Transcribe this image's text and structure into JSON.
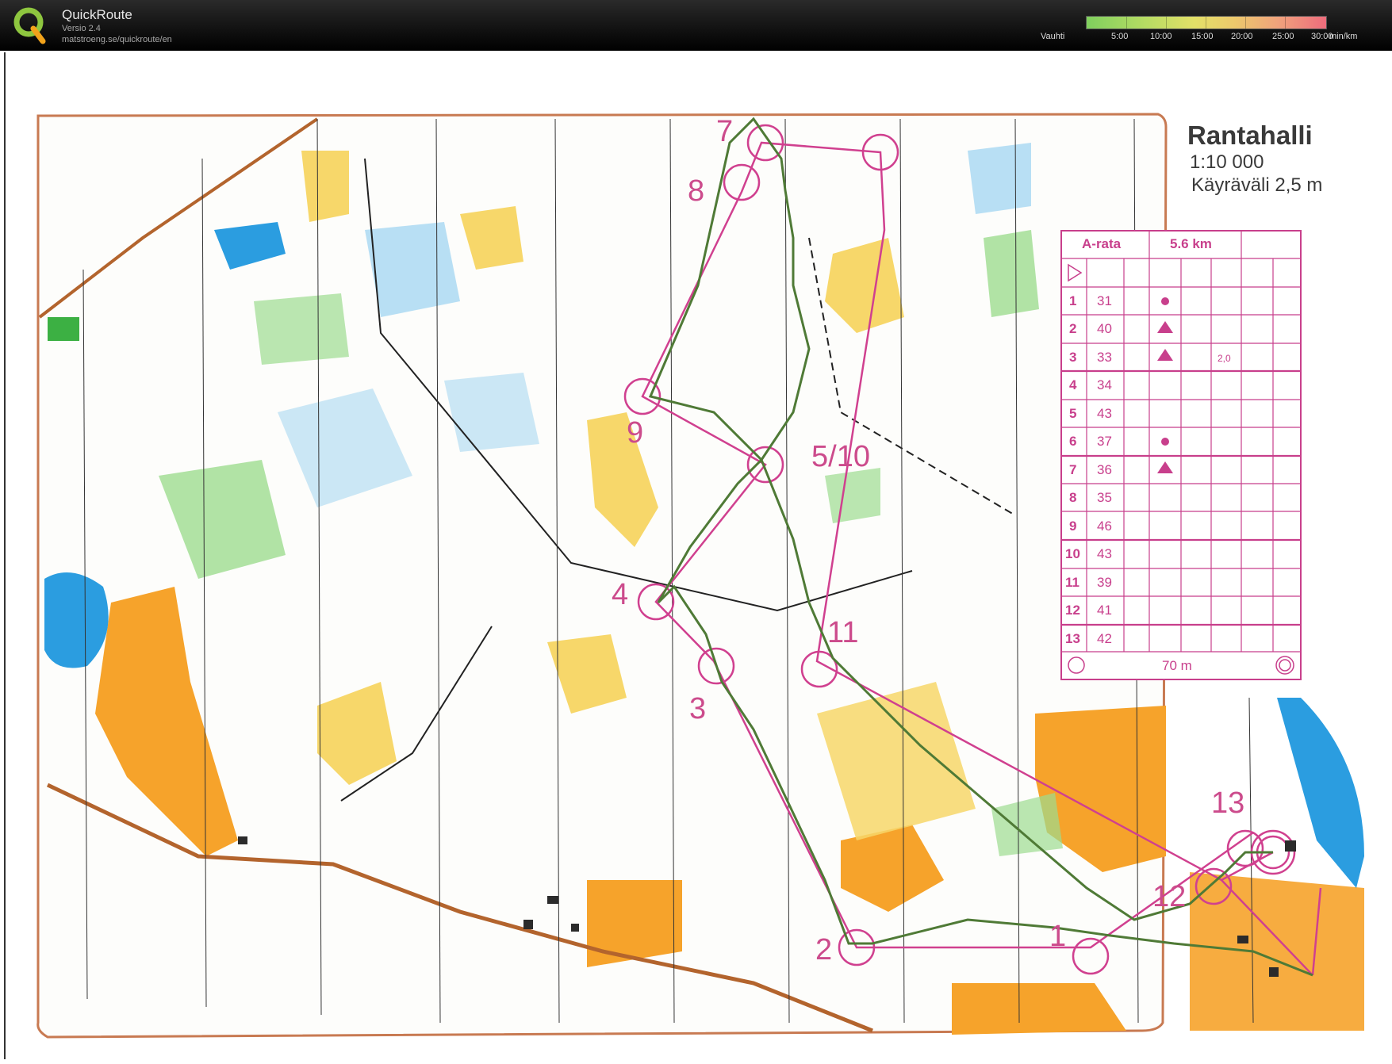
{
  "app": {
    "name": "QuickRoute",
    "version": "Versio 2.4",
    "url": "matstroeng.se/quickroute/en"
  },
  "pace": {
    "label": "Vauhti",
    "ticks": [
      "5:00",
      "10:00",
      "15:00",
      "20:00",
      "25:00",
      "30:00"
    ],
    "unit": "min/km",
    "colors": {
      "fast": "#7fcf5e",
      "mid": "#e3e068",
      "slow": "#ee6c7c"
    }
  },
  "map": {
    "title": "Rantahalli",
    "scale": "1:10 000",
    "contour": "Käyräväli 2,5 m",
    "colors": {
      "course": "#d0408f",
      "route": "#4f7a36",
      "open": "#f6a32b",
      "forest_green": "#9ddc90",
      "water": "#2b9de0",
      "frame": "#c87a52"
    },
    "control_labels": [
      "1",
      "2",
      "3",
      "4",
      "5/10",
      "7",
      "8",
      "9",
      "11",
      "12",
      "13"
    ],
    "description": {
      "course": "A-rata",
      "length": "5.6 km",
      "rows": [
        {
          "n": "1",
          "code": "31"
        },
        {
          "n": "2",
          "code": "40"
        },
        {
          "n": "3",
          "code": "33",
          "dim": "2,0"
        },
        {
          "n": "4",
          "code": "34"
        },
        {
          "n": "5",
          "code": "43"
        },
        {
          "n": "6",
          "code": "37"
        },
        {
          "n": "7",
          "code": "36"
        },
        {
          "n": "8",
          "code": "35"
        },
        {
          "n": "9",
          "code": "46"
        },
        {
          "n": "10",
          "code": "43"
        },
        {
          "n": "11",
          "code": "39"
        },
        {
          "n": "12",
          "code": "41"
        },
        {
          "n": "13",
          "code": "42"
        }
      ],
      "finish": "70 m"
    }
  }
}
